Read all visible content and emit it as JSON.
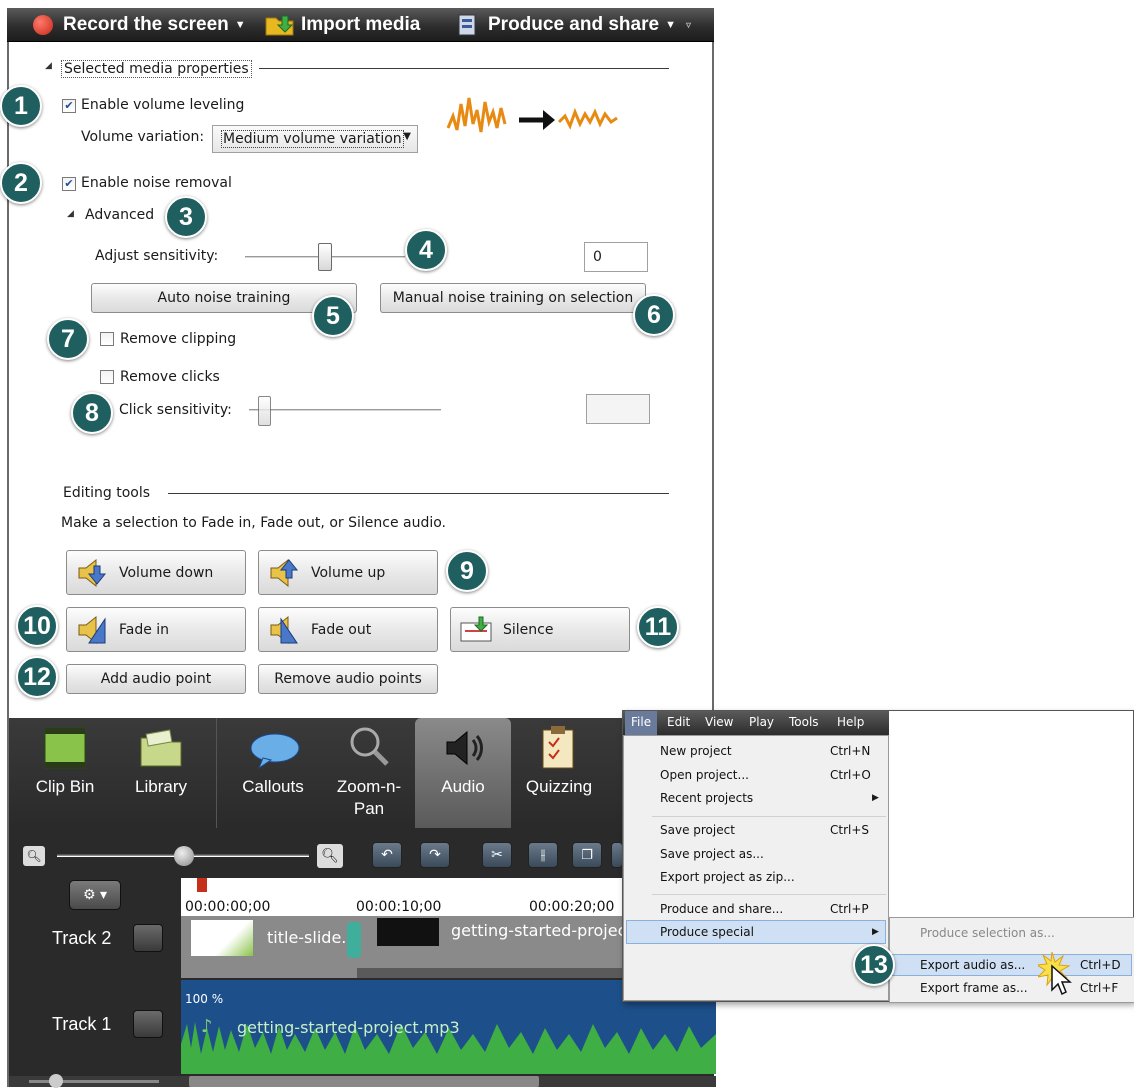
{
  "toolbar": {
    "record_label": "Record the screen",
    "import_label": "Import media",
    "produce_label": "Produce and share",
    "colors": {
      "record": "#d7301f",
      "import": "#e8b820"
    }
  },
  "properties": {
    "section_title": "Selected media properties",
    "enable_leveling_label": "Enable volume leveling",
    "enable_leveling_checked": true,
    "volume_variation_label": "Volume variation:",
    "volume_variation_value": "Medium volume variation",
    "enable_noise_label": "Enable noise removal",
    "enable_noise_checked": true,
    "advanced_label": "Advanced",
    "adjust_sensitivity_label": "Adjust sensitivity:",
    "sensitivity_level": 0.5,
    "sensitivity_value": "0",
    "auto_noise_label": "Auto noise training",
    "manual_noise_label": "Manual noise training on selection",
    "remove_clipping_label": "Remove clipping",
    "remove_clicks_label": "Remove clicks",
    "click_sensitivity_label": "Click sensitivity:",
    "click_sensitivity_level": 0.08
  },
  "editing": {
    "section_title": "Editing tools",
    "instructions": "Make a selection to Fade in, Fade out, or Silence audio.",
    "volume_down": "Volume down",
    "volume_up": "Volume up",
    "fade_in": "Fade in",
    "fade_out": "Fade out",
    "silence": "Silence",
    "add_point": "Add audio point",
    "remove_points": "Remove audio points"
  },
  "badges": [
    "1",
    "2",
    "3",
    "4",
    "5",
    "6",
    "7",
    "8",
    "9",
    "10",
    "11",
    "12",
    "13"
  ],
  "tabs": {
    "clip_bin": "Clip Bin",
    "library": "Library",
    "callouts": "Callouts",
    "zoom_pan": "Zoom-n-\nPan",
    "audio": "Audio",
    "quizzing": "Quizzing",
    "active": "Audio"
  },
  "timeline": {
    "time_0": "00:00:00;00",
    "time_1": "00:00:10;00",
    "time_2": "00:00:20;00",
    "track2_label": "Track 2",
    "track1_label": "Track 1",
    "clip_title": "title-slide.p",
    "clip_video": "getting-started-projec",
    "audio_volume": "100 %",
    "audio_clip": "getting-started-project.mp3",
    "colors": {
      "audio_wave": "#3fae45",
      "audio_bg": "#1d4f8a"
    }
  },
  "menu": {
    "bar": [
      "File",
      "Edit",
      "View",
      "Play",
      "Tools",
      "Help"
    ],
    "items": {
      "new_project": "New project",
      "new_project_key": "Ctrl+N",
      "open_project": "Open project...",
      "open_project_key": "Ctrl+O",
      "recent_projects": "Recent projects",
      "save_project": "Save project",
      "save_project_key": "Ctrl+S",
      "save_project_as": "Save project as...",
      "export_zip": "Export project as zip...",
      "produce_share": "Produce and share...",
      "produce_share_key": "Ctrl+P",
      "produce_special": "Produce special"
    },
    "submenu": {
      "produce_selection": "Produce selection as...",
      "export_audio": "Export audio as...",
      "export_audio_key": "Ctrl+D",
      "export_frame": "Export frame as...",
      "export_frame_key": "Ctrl+F"
    }
  }
}
